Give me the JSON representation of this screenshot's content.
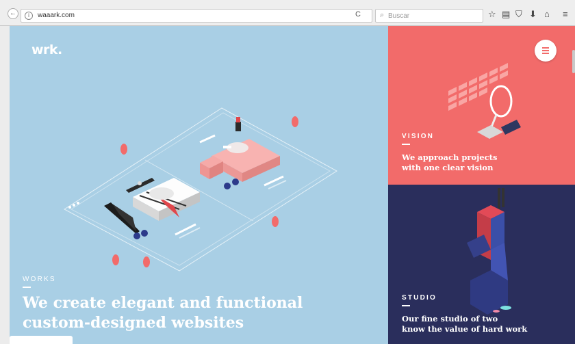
{
  "browser": {
    "url": "waaark.com",
    "search_placeholder": "Buscar",
    "reload_glyph": "C",
    "back_glyph": "←",
    "info_glyph": "i",
    "icons": [
      "star-icon",
      "reading-list-icon",
      "pocket-icon",
      "download-icon",
      "home-icon",
      "menu-icon"
    ],
    "icon_glyphs": [
      "☆",
      "▤",
      "⛉",
      "⬇",
      "⌂",
      "≡"
    ]
  },
  "site": {
    "logo": "wrk.",
    "colors": {
      "works_bg": "#a9cfe5",
      "vision_bg": "#f26b6a",
      "studio_bg": "#2a2e5c"
    }
  },
  "works": {
    "label": "WORKS",
    "headline_line1": "We create elegant and functional",
    "headline_line2": "custom-designed websites"
  },
  "vision": {
    "label": "VISION",
    "text_line1": "We approach projects",
    "text_line2": "with one clear vision"
  },
  "studio": {
    "label": "STUDIO",
    "text_line1": "Our fine studio of two",
    "text_line2": "know the value of hard work"
  }
}
